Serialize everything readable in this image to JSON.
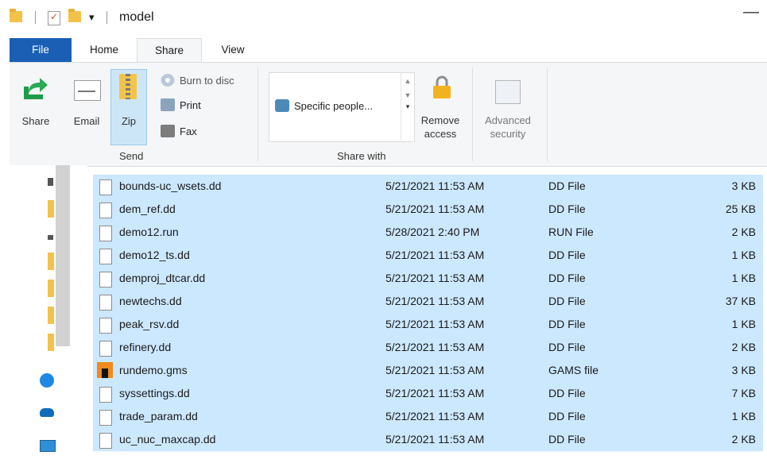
{
  "window": {
    "title": "model"
  },
  "ribbon_tabs": [
    "File",
    "Home",
    "Share",
    "View"
  ],
  "ribbon": {
    "send_group": {
      "label": "Send",
      "share": "Share",
      "email": "Email",
      "zip": "Zip",
      "burn": "Burn to disc",
      "print": "Print",
      "fax": "Fax"
    },
    "share_with_group": {
      "label": "Share with",
      "specific_people": "Specific people...",
      "remove_access": "Remove access"
    },
    "advanced_security": "Advanced security"
  },
  "files": [
    {
      "name": "bounds-uc_wsets.dd",
      "date": "5/21/2021 11:53 AM",
      "type": "DD File",
      "size": "3 KB",
      "icon": "file-icon"
    },
    {
      "name": "dem_ref.dd",
      "date": "5/21/2021 11:53 AM",
      "type": "DD File",
      "size": "25 KB",
      "icon": "file-icon"
    },
    {
      "name": "demo12.run",
      "date": "5/28/2021 2:40 PM",
      "type": "RUN File",
      "size": "2 KB",
      "icon": "file-icon"
    },
    {
      "name": "demo12_ts.dd",
      "date": "5/21/2021 11:53 AM",
      "type": "DD File",
      "size": "1 KB",
      "icon": "file-icon"
    },
    {
      "name": "demproj_dtcar.dd",
      "date": "5/21/2021 11:53 AM",
      "type": "DD File",
      "size": "1 KB",
      "icon": "file-icon"
    },
    {
      "name": "newtechs.dd",
      "date": "5/21/2021 11:53 AM",
      "type": "DD File",
      "size": "37 KB",
      "icon": "file-icon"
    },
    {
      "name": "peak_rsv.dd",
      "date": "5/21/2021 11:53 AM",
      "type": "DD File",
      "size": "1 KB",
      "icon": "file-icon"
    },
    {
      "name": "refinery.dd",
      "date": "5/21/2021 11:53 AM",
      "type": "DD File",
      "size": "2 KB",
      "icon": "file-icon"
    },
    {
      "name": "rundemo.gms",
      "date": "5/21/2021 11:53 AM",
      "type": "GAMS file",
      "size": "3 KB",
      "icon": "gams-file-icon"
    },
    {
      "name": "syssettings.dd",
      "date": "5/21/2021 11:53 AM",
      "type": "DD File",
      "size": "7 KB",
      "icon": "file-icon"
    },
    {
      "name": "trade_param.dd",
      "date": "5/21/2021 11:53 AM",
      "type": "DD File",
      "size": "1 KB",
      "icon": "file-icon"
    },
    {
      "name": "uc_nuc_maxcap.dd",
      "date": "5/21/2021 11:53 AM",
      "type": "DD File",
      "size": "2 KB",
      "icon": "file-icon"
    }
  ],
  "colors": {
    "file_tab": "#1a5fb4",
    "selection": "#cce8ff",
    "ribbon_bg": "#f5f6f7"
  }
}
